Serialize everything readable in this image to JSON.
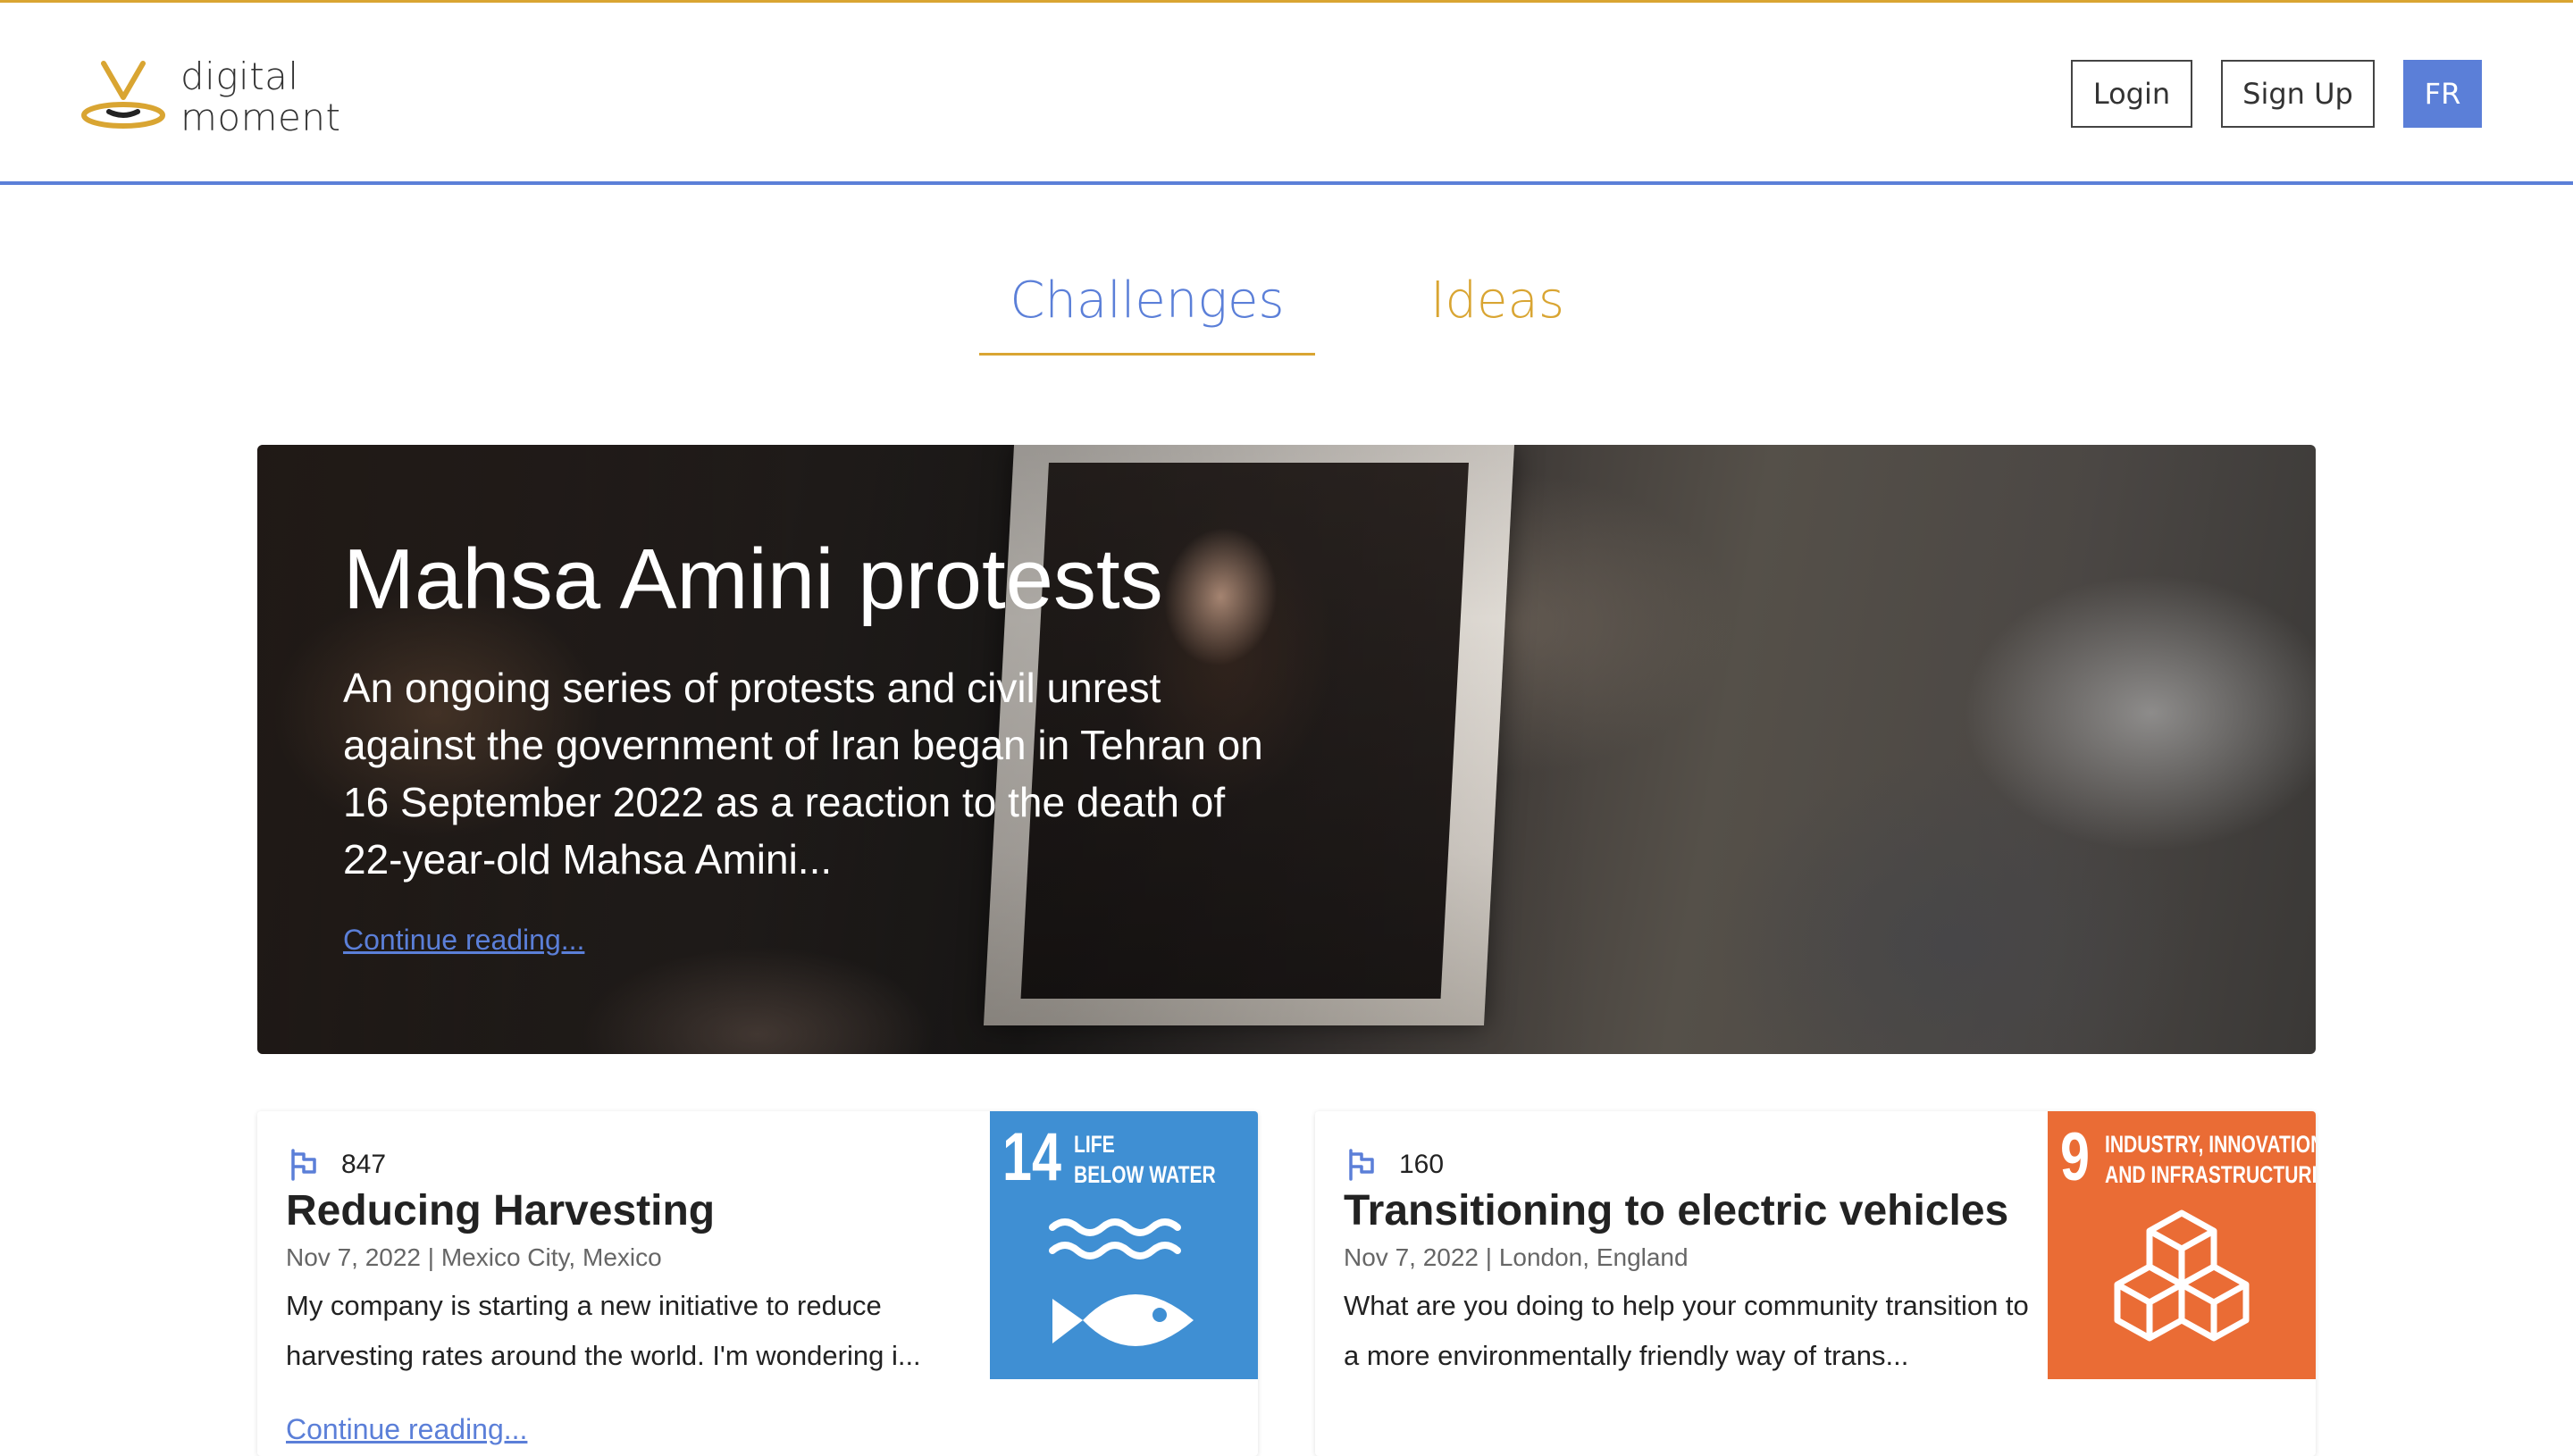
{
  "brand": {
    "name_line1": "digital",
    "name_line2": "moment",
    "colors": {
      "primary": "#5b7fd8",
      "accent": "#d9a532"
    }
  },
  "header": {
    "login_label": "Login",
    "signup_label": "Sign Up",
    "language_label": "FR"
  },
  "tabs": [
    {
      "label": "Challenges",
      "active": true
    },
    {
      "label": "Ideas",
      "active": false
    }
  ],
  "featured": {
    "title": "Mahsa Amini protests",
    "description": "An ongoing series of protests and civil unrest against the government of Iran began in Tehran on 16 September 2022 as a reaction to the death of 22-year-old Mahsa Amini...",
    "link_label": "Continue reading..."
  },
  "cards": [
    {
      "icon": "flag-icon",
      "count": "847",
      "title": "Reducing Harvesting",
      "date": "Nov 7, 2022",
      "location": "Mexico City, Mexico",
      "meta_line": "Nov 7, 2022 | Mexico City, Mexico",
      "excerpt": "My company is starting a new initiative to reduce harvesting rates around the world. I'm wondering i...",
      "link_label": "Continue reading...",
      "sdg": {
        "number": "14",
        "label_line1": "LIFE",
        "label_line2": "BELOW WATER",
        "color": "#3f8fd3",
        "icon": "fish-waves-icon"
      }
    },
    {
      "icon": "flag-icon",
      "count": "160",
      "title": "Transitioning to electric vehicles",
      "date": "Nov 7, 2022",
      "location": "London, England",
      "meta_line": "Nov 7, 2022 | London, England",
      "excerpt": "What are you doing to help your community transition to a more environmentally friendly way of trans...",
      "sdg": {
        "number": "9",
        "label_line1": "INDUSTRY, INNOVATION",
        "label_line2": "AND INFRASTRUCTURE",
        "color": "#ea6c35",
        "icon": "cubes-icon"
      }
    }
  ]
}
